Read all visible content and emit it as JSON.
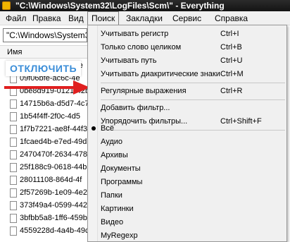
{
  "window": {
    "title": "\"C:\\Windows\\System32\\LogFiles\\Scm\\\" - Everything"
  },
  "menubar": {
    "file": "Файл",
    "edit": "Правка",
    "view": "Вид",
    "search": "Поиск",
    "bookmarks": "Закладки",
    "service": "Сервис",
    "help": "Справка"
  },
  "search": {
    "value": "\"C:\\Windows\\System32"
  },
  "list": {
    "column_name": "Имя",
    "rows": [
      "083482fa-85b8-4e",
      "09f06bfe-ac6c-4e",
      "0be8d919-0121-42b",
      "14715b6a-d5d7-4c7",
      "1b54f4ff-2f0c-4d5",
      "1f7b7221-ae8f-44f3",
      "1fcaed4b-e7ed-49d",
      "2470470f-2634-478",
      "25f188c9-0618-44b",
      "28011108-864d-4f",
      "2f57269b-1e09-4e2",
      "373f49a4-0599-442",
      "3bfbb5a8-1ff6-459b",
      "4559228d-4a4b-49c"
    ]
  },
  "overlay": {
    "badge": "ОТКЛЮЧИТЬ"
  },
  "dropdown": {
    "match_case": {
      "label": "Учитывать регистр",
      "shortcut": "Ctrl+I"
    },
    "whole_word": {
      "label": "Только слово целиком",
      "shortcut": "Ctrl+B"
    },
    "match_path": {
      "label": "Учитывать путь",
      "shortcut": "Ctrl+U"
    },
    "diacritics": {
      "label": "Учитывать диакритические знаки",
      "shortcut": "Ctrl+M"
    },
    "regex": {
      "label": "Регулярные выражения",
      "shortcut": "Ctrl+R"
    },
    "add_filter": {
      "label": "Добавить фильтр..."
    },
    "organize_filters": {
      "label": "Упорядочить фильтры...",
      "shortcut": "Ctrl+Shift+F"
    },
    "filters": [
      "Всё",
      "Аудио",
      "Архивы",
      "Документы",
      "Программы",
      "Папки",
      "Картинки",
      "Видео",
      "MyRegexp"
    ]
  },
  "colors": {
    "badge_text": "#3a8dd8",
    "arrow": "#e02020"
  }
}
